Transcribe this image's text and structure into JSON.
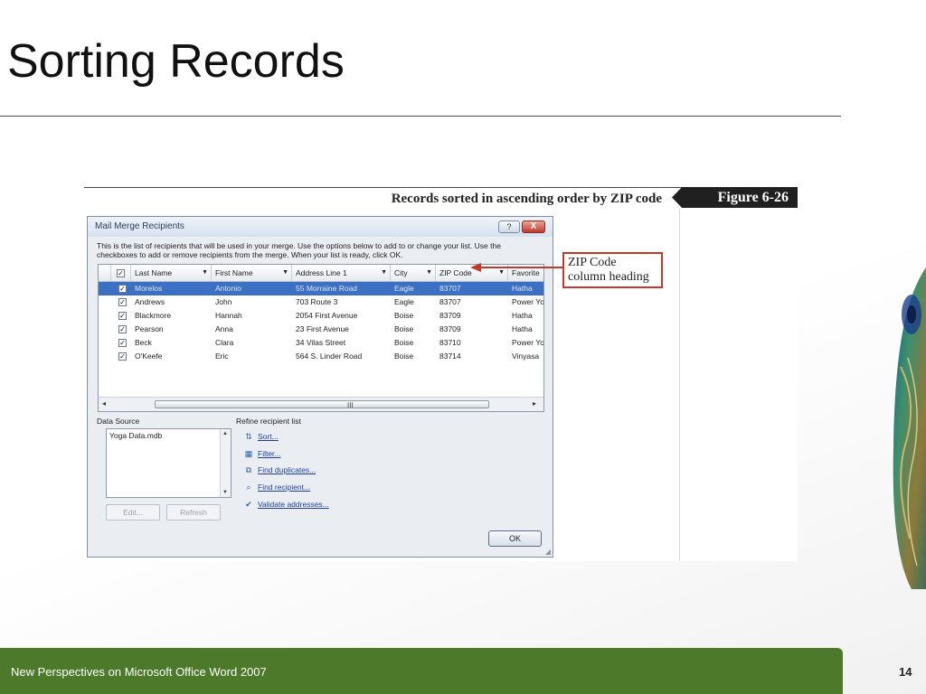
{
  "slide": {
    "title": "Sorting Records",
    "footer_text": "New Perspectives on Microsoft Office Word 2007",
    "page_number": "14"
  },
  "figure": {
    "caption": "Records sorted in ascending order by ZIP code",
    "label": "Figure  6-26"
  },
  "callout": {
    "line1": "ZIP Code",
    "line2": "column heading"
  },
  "dialog": {
    "title": "Mail Merge Recipients",
    "help_label": "?",
    "close_label": "X",
    "instructions": "This is the list of recipients that will be used in your merge.  Use the options below to add to or change your list.  Use the checkboxes to add or remove recipients from the merge.  When your list is ready, click OK.",
    "columns": [
      "Last Name",
      "First Name",
      "Address Line 1",
      "City",
      "ZIP Code",
      "Favorite"
    ],
    "rows": [
      {
        "last": "Morelos",
        "first": "Antonio",
        "address": "55 Morraine Road",
        "city": "Eagle",
        "zip": "83707",
        "favorite": "Hatha",
        "checked": true,
        "selected": true
      },
      {
        "last": "Andrews",
        "first": "John",
        "address": "703 Route 3",
        "city": "Eagle",
        "zip": "83707",
        "favorite": "Power Yoga",
        "checked": true,
        "selected": false
      },
      {
        "last": "Blackmore",
        "first": "Hannah",
        "address": "2054 First Avenue",
        "city": "Boise",
        "zip": "83709",
        "favorite": "Hatha",
        "checked": true,
        "selected": false
      },
      {
        "last": "Pearson",
        "first": "Anna",
        "address": "23 First Avenue",
        "city": "Boise",
        "zip": "83709",
        "favorite": "Hatha",
        "checked": true,
        "selected": false
      },
      {
        "last": "Beck",
        "first": "Clara",
        "address": "34 Vilas Street",
        "city": "Boise",
        "zip": "83710",
        "favorite": "Power Yoga",
        "checked": true,
        "selected": false
      },
      {
        "last": "O'Keefe",
        "first": "Eric",
        "address": "564 S. Linder Road",
        "city": "Boise",
        "zip": "83714",
        "favorite": "Vinyasa",
        "checked": true,
        "selected": false
      }
    ],
    "scroll_grip": "III",
    "data_source_label": "Data Source",
    "data_source_item": "Yoga Data.mdb",
    "edit_label": "Edit...",
    "refresh_label": "Refresh",
    "refine_label": "Refine recipient list",
    "refine_items": [
      "Sort...",
      "Filter...",
      "Find duplicates...",
      "Find recipient...",
      "Validate addresses..."
    ],
    "ok_label": "OK"
  },
  "colors": {
    "footer_green": "#4d7a2a",
    "selected_row": "#3b70c3",
    "callout_red": "#c0392b"
  }
}
